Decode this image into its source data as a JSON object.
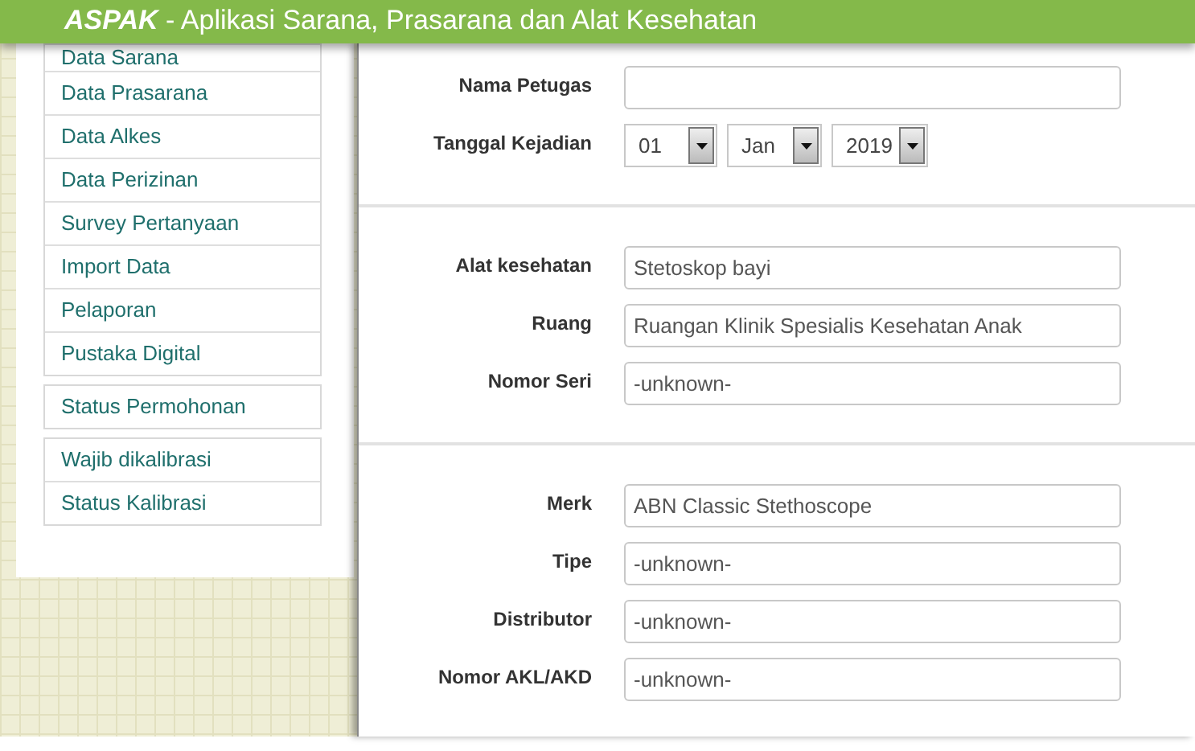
{
  "header": {
    "brand": "ASPAK",
    "title": " - Aplikasi Sarana, Prasarana dan Alat Kesehatan"
  },
  "sidebar": {
    "groups": [
      {
        "items": [
          "Data Sarana",
          "Data Prasarana",
          "Data Alkes",
          "Data Perizinan",
          "Survey Pertanyaan",
          "Import Data",
          "Pelaporan",
          "Pustaka Digital"
        ]
      },
      {
        "items": [
          "Status Permohonan"
        ]
      },
      {
        "items": [
          "Wajib dikalibrasi",
          "Status Kalibrasi"
        ]
      }
    ]
  },
  "form": {
    "sections": [
      {
        "fields": [
          {
            "kind": "text",
            "label": "Nama Petugas"
          },
          {
            "kind": "date",
            "label": "Tanggal Kejadian",
            "parts": [
              "01",
              "Jan",
              "2019"
            ]
          }
        ]
      },
      {
        "fields": [
          {
            "kind": "text",
            "label": "Alat kesehatan",
            "value": "Stetoskop bayi"
          },
          {
            "kind": "text",
            "label": "Ruang",
            "value": "Ruangan Klinik Spesialis Kesehatan Anak"
          },
          {
            "kind": "text",
            "label": "Nomor Seri",
            "value": "-unknown-"
          }
        ]
      },
      {
        "fields": [
          {
            "kind": "text",
            "label": "Merk",
            "value": "ABN Classic Stethoscope"
          },
          {
            "kind": "text",
            "label": "Tipe",
            "value": "-unknown-"
          },
          {
            "kind": "text",
            "label": "Distributor",
            "value": "-unknown-"
          },
          {
            "kind": "text",
            "label": "Nomor AKL/AKD",
            "value": "-unknown-"
          }
        ]
      }
    ]
  }
}
